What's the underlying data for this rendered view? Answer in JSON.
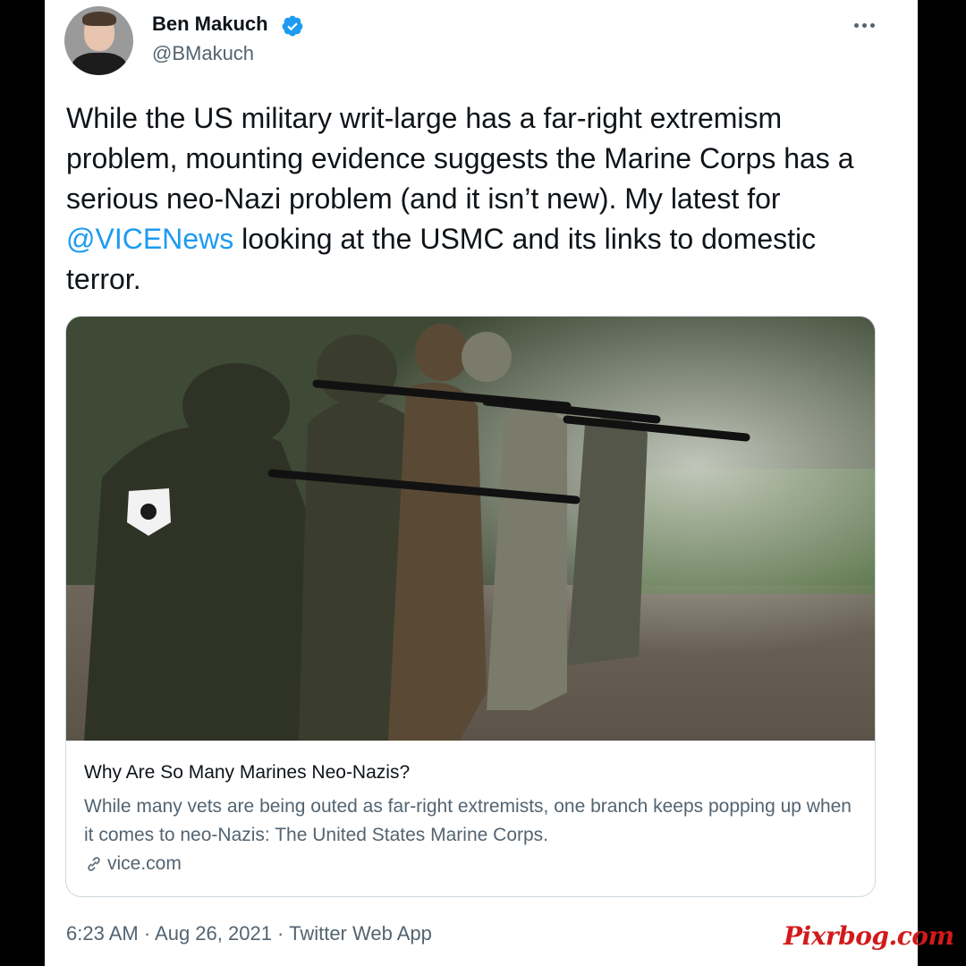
{
  "author": {
    "name": "Ben Makuch",
    "handle": "@BMakuch"
  },
  "tweet": {
    "text_before_mention": "While the US military writ-large has a far-right extremism problem, mounting evidence suggests the Marine Corps has a serious neo-Nazi problem (and it isn’t new). My latest for ",
    "mention": "@VICENews",
    "text_after_mention": " looking at the USMC and its links to domestic terror."
  },
  "link_card": {
    "title": "Why Are So Many Marines Neo-Nazis?",
    "description": "While many vets are being outed as far-right extremists, one branch keeps popping up when it comes to neo-Nazis: The United States Marine Corps.",
    "domain": "vice.com"
  },
  "meta": {
    "timestamp": "6:23 AM · Aug 26, 2021 · Twitter Web App"
  },
  "watermark": "Pixrbog.com",
  "icons": {
    "verified": "verified-badge-icon",
    "more": "more-options-icon",
    "link": "link-icon"
  },
  "colors": {
    "accent": "#1d9bf0",
    "text": "#0f1419",
    "secondary_text": "#536471",
    "border": "#cfd9de",
    "watermark": "#d31a1a"
  }
}
